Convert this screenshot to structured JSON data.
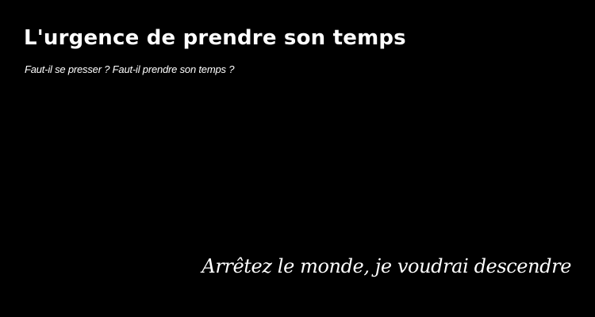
{
  "header": {
    "title": "L'urgence de prendre son temps",
    "tagline": "Faut-il se presser ? Faut-il prendre son temps ?"
  },
  "hero": {
    "quote": "Arrêtez le monde, je voudrai descendre"
  },
  "colors": {
    "background": "#000000",
    "text": "#ffffff"
  }
}
